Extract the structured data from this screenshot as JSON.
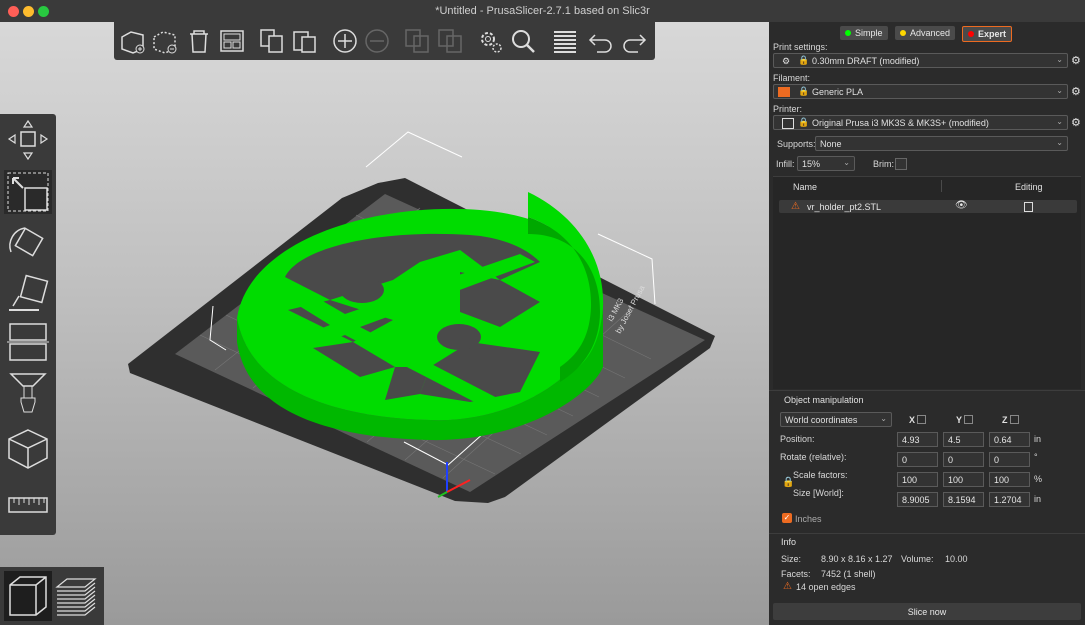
{
  "window": {
    "title": "*Untitled - PrusaSlicer-2.7.1 based on Slic3r"
  },
  "colors": {
    "accent": "#ed6b21",
    "model": "#00dc00",
    "bed": "#2f2f2f"
  },
  "mode": {
    "simple": "Simple",
    "advanced": "Advanced",
    "expert": "Expert"
  },
  "settings": {
    "print_label": "Print settings:",
    "print_value": "0.30mm DRAFT (modified)",
    "filament_label": "Filament:",
    "filament_value": "Generic PLA",
    "printer_label": "Printer:",
    "printer_value": "Original Prusa i3 MK3S & MK3S+ (modified)",
    "supports_label": "Supports:",
    "supports_value": "None",
    "infill_label": "Infill:",
    "infill_value": "15%",
    "brim_label": "Brim:"
  },
  "objects": {
    "col_name": "Name",
    "col_editing": "Editing",
    "items": [
      {
        "name": "vr_holder_pt2.STL"
      }
    ]
  },
  "manip": {
    "title": "Object manipulation",
    "coord_system": "World coordinates",
    "x": "X",
    "y": "Y",
    "z": "Z",
    "position_label": "Position:",
    "position": [
      "4.93",
      "4.5",
      "0.64"
    ],
    "position_unit": "in",
    "rotate_label": "Rotate (relative):",
    "rotate": [
      "0",
      "0",
      "0"
    ],
    "rotate_unit": "°",
    "scale_label": "Scale factors:",
    "scale": [
      "100",
      "100",
      "100"
    ],
    "scale_unit": "%",
    "size_label": "Size [World]:",
    "size": [
      "8.9005",
      "8.1594",
      "1.2704"
    ],
    "size_unit": "in",
    "inches_label": "Inches"
  },
  "info": {
    "title": "Info",
    "size_label": "Size:",
    "size_value": "8.90 x 8.16 x 1.27",
    "volume_label": "Volume:",
    "volume_value": "10.00",
    "facets_label": "Facets:",
    "facets_value": "7452 (1 shell)",
    "open_edges": "14 open edges"
  },
  "bed": {
    "label_line1": "i3 MK3",
    "label_line2": "by Josef Prusa"
  },
  "slice_button": "Slice now"
}
